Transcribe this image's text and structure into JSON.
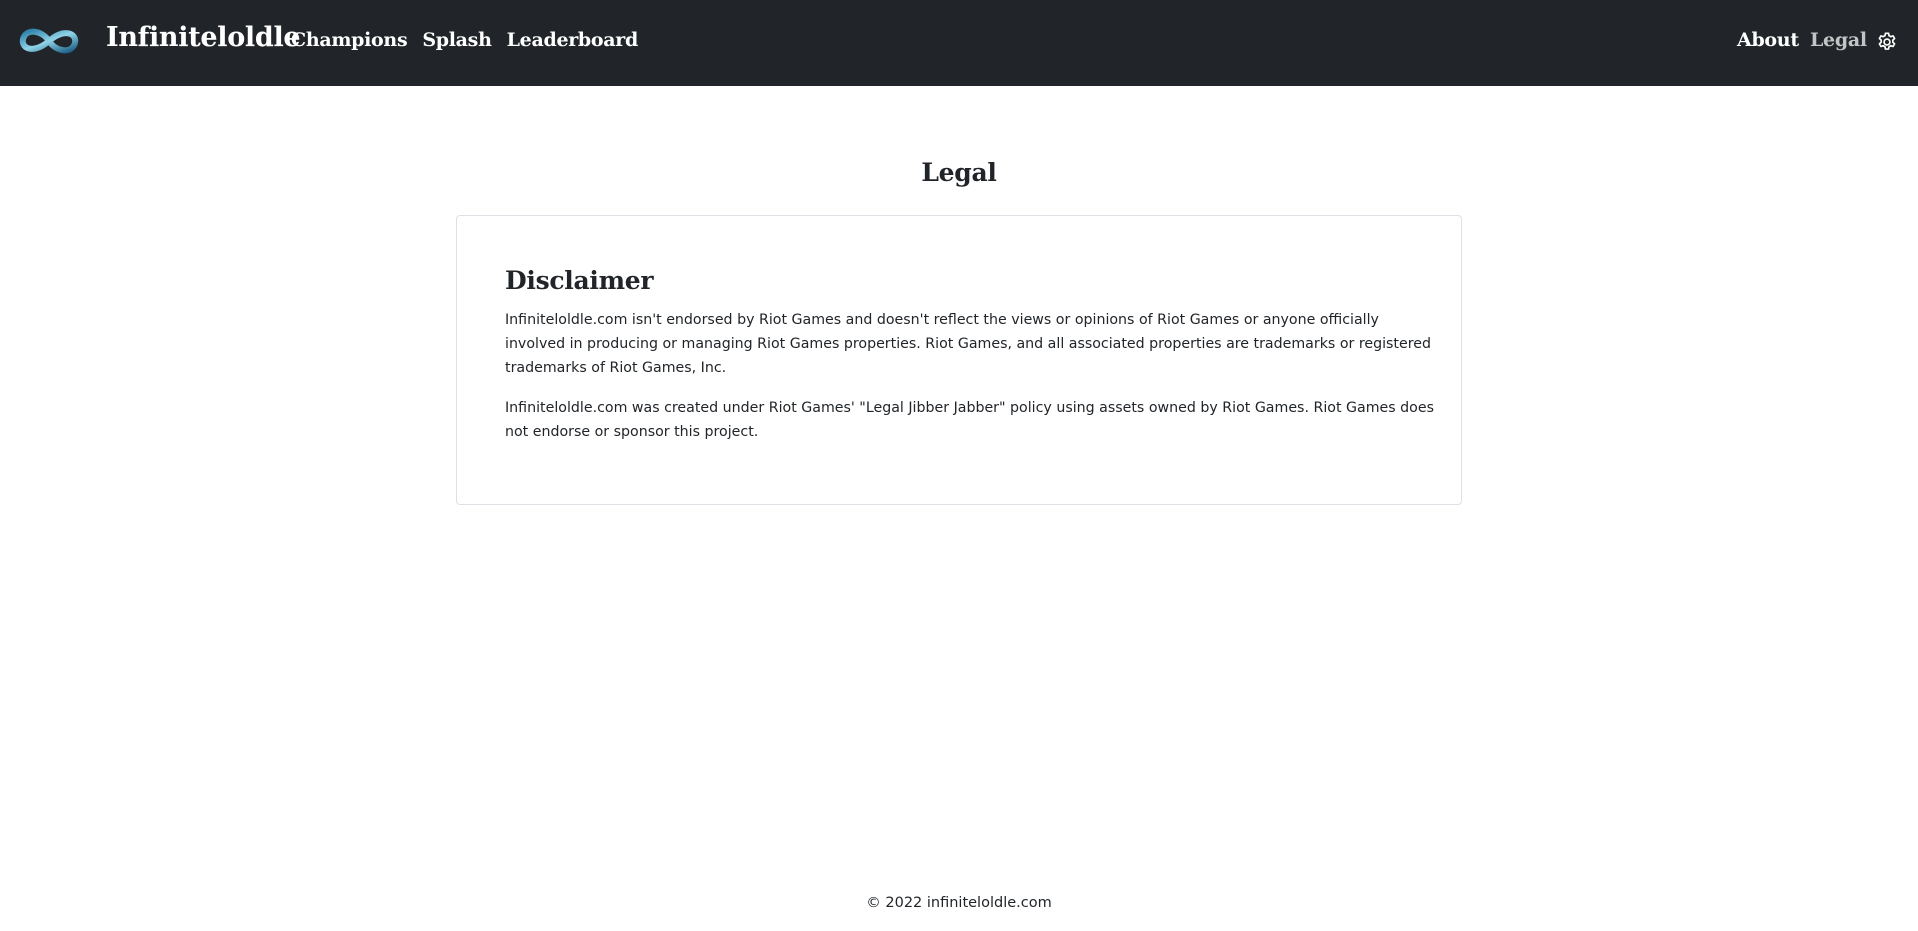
{
  "navbar": {
    "brand": "Infiniteloldle",
    "links": [
      {
        "label": "Champions"
      },
      {
        "label": "Splash"
      },
      {
        "label": "Leaderboard"
      }
    ],
    "about_label": "About",
    "legal_label": "Legal",
    "logo_icon": "infinity-logo-icon",
    "settings_icon": "gear-icon",
    "background_color": "#212529",
    "active_link_color": "#c2c4c6"
  },
  "page": {
    "title": "Legal"
  },
  "disclaimer": {
    "heading": "Disclaimer",
    "paragraph1": "Infiniteloldle.com isn't endorsed by Riot Games and doesn't reflect the views or opinions of Riot Games or anyone officially involved in producing or managing Riot Games properties. Riot Games, and all associated properties are trademarks or registered trademarks of Riot Games, Inc.",
    "paragraph2": "Infiniteloldle.com was created under Riot Games' \"Legal Jibber Jabber\" policy using assets owned by Riot Games. Riot Games does not endorse or sponsor this project."
  },
  "footer": {
    "text": "© 2022 infiniteloldle.com"
  }
}
